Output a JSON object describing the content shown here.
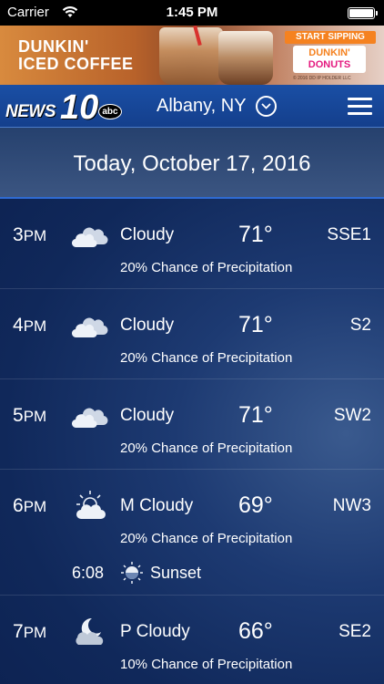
{
  "status_bar": {
    "carrier": "Carrier",
    "time": "1:45 PM"
  },
  "ad": {
    "headline_line1": "DUNKIN'",
    "headline_line2": "ICED COFFEE",
    "cta": "START SIPPING",
    "brand_line1": "DUNKIN'",
    "brand_line2": "DONUTS",
    "legal": "© 2016 DD IP HOLDER LLC"
  },
  "header": {
    "logo_text": "NEWS",
    "logo_number": "10",
    "logo_network": "abc",
    "location": "Albany, NY"
  },
  "date_banner": "Today, October 17, 2016",
  "rows": [
    {
      "hour": "3",
      "ampm": "PM",
      "icon": "cloudy-icon",
      "condition": "Cloudy",
      "temp": "71°",
      "wind": "SSE1",
      "precip": "20% Chance of Precipitation"
    },
    {
      "hour": "4",
      "ampm": "PM",
      "icon": "cloudy-icon",
      "condition": "Cloudy",
      "temp": "71°",
      "wind": "S2",
      "precip": "20% Chance of Precipitation"
    },
    {
      "hour": "5",
      "ampm": "PM",
      "icon": "cloudy-icon",
      "condition": "Cloudy",
      "temp": "71°",
      "wind": "SW2",
      "precip": "20% Chance of Precipitation"
    },
    {
      "hour": "6",
      "ampm": "PM",
      "icon": "mostly-cloudy-sun-icon",
      "condition": "M Cloudy",
      "temp": "69°",
      "wind": "NW3",
      "precip": "20% Chance of Precipitation",
      "sun_time": "6:08",
      "sun_label": "Sunset"
    },
    {
      "hour": "7",
      "ampm": "PM",
      "icon": "partly-cloudy-moon-icon",
      "condition": "P Cloudy",
      "temp": "66°",
      "wind": "SE2",
      "precip": "10% Chance of Precipitation"
    }
  ]
}
